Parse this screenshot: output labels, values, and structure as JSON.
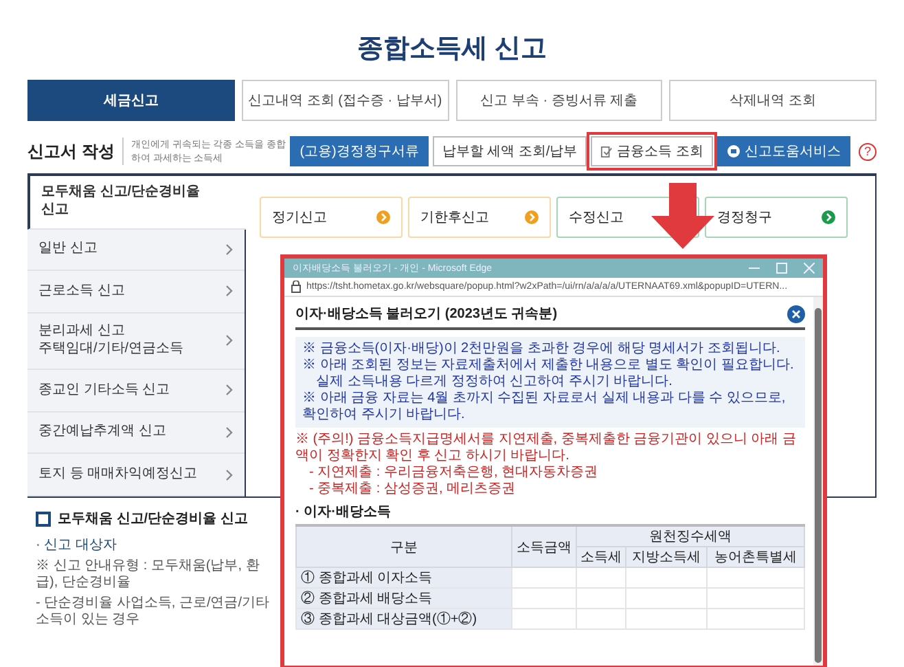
{
  "page_title": "종합소득세 신고",
  "tabs": [
    {
      "label": "세금신고",
      "selected": true
    },
    {
      "label": "신고내역 조회 (접수증 · 납부서)",
      "selected": false
    },
    {
      "label": "신고 부속 · 증빙서류 제출",
      "selected": false
    },
    {
      "label": "삭제내역 조회",
      "selected": false
    }
  ],
  "section": {
    "title": "신고서 작성",
    "description": "개인에게 귀속되는 각종 소득을 종합하여 과세하는 소득세"
  },
  "toolbar_buttons": [
    {
      "label": "(고용)경정청구서류",
      "kind": "primary"
    },
    {
      "label": "납부할 세액 조회/납부",
      "kind": "outline"
    },
    {
      "label": "금융소득 조회",
      "kind": "highlighted"
    },
    {
      "label": "신고도움서비스",
      "kind": "service"
    }
  ],
  "help": "?",
  "sidebar": [
    {
      "label": "모두채움 신고/단순경비율\n신고",
      "selected": true
    },
    {
      "label": "일반 신고",
      "selected": false
    },
    {
      "label": "근로소득 신고",
      "selected": false
    },
    {
      "label": "분리과세 신고\n주택임대/기타/연금소득",
      "selected": false
    },
    {
      "label": "종교인 기타소득 신고",
      "selected": false
    },
    {
      "label": "중간예납추계액 신고",
      "selected": false
    },
    {
      "label": "토지 등 매매차익예정신고",
      "selected": false
    }
  ],
  "cards": [
    {
      "label": "정기신고",
      "color": "#f0a020"
    },
    {
      "label": "기한후신고",
      "color": "#f0a020"
    },
    {
      "label": "수정신고"
    },
    {
      "label": "경정청구",
      "color": "#1a9a4a"
    }
  ],
  "popup": {
    "window_title": "이자배당소득 불러오기 - 개인 - Microsoft Edge",
    "url": "https://tsht.hometax.go.kr/websquare/popup.html?w2xPath=/ui/rn/a/a/a/a/UTERNAAT69.xml&popupID=UTERN...",
    "heading": "이자·배당소득 불러오기 (2023년도 귀속분)",
    "notices": [
      "※ 금융소득(이자·배당)이 2천만원을 초과한 경우에 해당 명세서가 조회됩니다.",
      "※ 아래 조회된 정보는 자료제출처에서 제출한 내용으로 별도 확인이 필요합니다.",
      "실제 소득내용 다르게 정정하여 신고하여 주시기 바랍니다.",
      "※ 아래 금융 자료는 4월 초까지 수집된 자료로서 실제 내용과 다를 수 있으므로, 확인하여 주시기 바랍니다."
    ],
    "warnings": [
      "※ (주의!) 금융소득지급명세서를 지연제출, 중복제출한 금융기관이 있으니 아래 금액이 정확한지 확인 후 신고 하시기 바랍니다.",
      "- 지연제출 : 우리금융저축은행, 현대자동차증권",
      "- 중복제출 : 삼성증권, 메리츠증권"
    ],
    "table_title": "· 이자·배당소득",
    "table": {
      "columns": [
        "구분",
        "소득금액"
      ],
      "group": {
        "label": "원천징수세액",
        "columns": [
          "소득세",
          "지방소득세",
          "농어촌특별세"
        ]
      },
      "rows": [
        "① 종합과세 이자소득",
        "② 종합과세 배당소득",
        "③ 종합과세 대상금액(①+②)"
      ]
    }
  },
  "guide": {
    "title": "모두채움 신고/단순경비율 신고",
    "subtitle": "· 신고 대상자",
    "lines": [
      "※ 신고 안내유형 : 모두채움(납부, 환급), 단순경비율",
      "- 단순경비율 사업소득, 근로/연금/기타소득이 있는 경우"
    ]
  }
}
